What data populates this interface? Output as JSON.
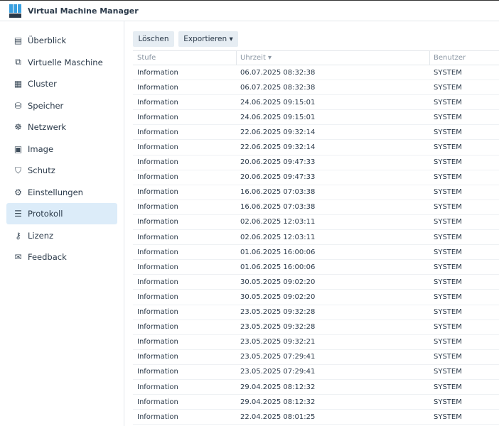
{
  "app": {
    "title": "Virtual Machine Manager"
  },
  "sidebar": {
    "items": [
      {
        "label": "Überblick",
        "icon": "overview-icon",
        "glyph": "▤"
      },
      {
        "label": "Virtuelle Maschine",
        "icon": "virtual-machine-icon",
        "glyph": "⧉"
      },
      {
        "label": "Cluster",
        "icon": "cluster-icon",
        "glyph": "▦"
      },
      {
        "label": "Speicher",
        "icon": "storage-icon",
        "glyph": "⛁"
      },
      {
        "label": "Netzwerk",
        "icon": "network-icon",
        "glyph": "☸"
      },
      {
        "label": "Image",
        "icon": "image-icon",
        "glyph": "▣"
      },
      {
        "label": "Schutz",
        "icon": "shield-icon",
        "glyph": "⛉"
      },
      {
        "label": "Einstellungen",
        "icon": "gear-icon",
        "glyph": "⚙"
      },
      {
        "label": "Protokoll",
        "icon": "list-icon",
        "glyph": "☰",
        "active": true
      },
      {
        "label": "Lizenz",
        "icon": "key-icon",
        "glyph": "⚷"
      },
      {
        "label": "Feedback",
        "icon": "mail-icon",
        "glyph": "✉"
      }
    ]
  },
  "toolbar": {
    "delete_label": "Löschen",
    "export_label": "Exportieren ▾"
  },
  "table": {
    "columns": [
      "Stufe",
      "Uhrzeit ▾",
      "Benutzer"
    ],
    "rows": [
      [
        "Information",
        "06.07.2025 08:32:38",
        "SYSTEM"
      ],
      [
        "Information",
        "06.07.2025 08:32:38",
        "SYSTEM"
      ],
      [
        "Information",
        "24.06.2025 09:15:01",
        "SYSTEM"
      ],
      [
        "Information",
        "24.06.2025 09:15:01",
        "SYSTEM"
      ],
      [
        "Information",
        "22.06.2025 09:32:14",
        "SYSTEM"
      ],
      [
        "Information",
        "22.06.2025 09:32:14",
        "SYSTEM"
      ],
      [
        "Information",
        "20.06.2025 09:47:33",
        "SYSTEM"
      ],
      [
        "Information",
        "20.06.2025 09:47:33",
        "SYSTEM"
      ],
      [
        "Information",
        "16.06.2025 07:03:38",
        "SYSTEM"
      ],
      [
        "Information",
        "16.06.2025 07:03:38",
        "SYSTEM"
      ],
      [
        "Information",
        "02.06.2025 12:03:11",
        "SYSTEM"
      ],
      [
        "Information",
        "02.06.2025 12:03:11",
        "SYSTEM"
      ],
      [
        "Information",
        "01.06.2025 16:00:06",
        "SYSTEM"
      ],
      [
        "Information",
        "01.06.2025 16:00:06",
        "SYSTEM"
      ],
      [
        "Information",
        "30.05.2025 09:02:20",
        "SYSTEM"
      ],
      [
        "Information",
        "30.05.2025 09:02:20",
        "SYSTEM"
      ],
      [
        "Information",
        "23.05.2025 09:32:28",
        "SYSTEM"
      ],
      [
        "Information",
        "23.05.2025 09:32:28",
        "SYSTEM"
      ],
      [
        "Information",
        "23.05.2025 09:32:21",
        "SYSTEM"
      ],
      [
        "Information",
        "23.05.2025 07:29:41",
        "SYSTEM"
      ],
      [
        "Information",
        "23.05.2025 07:29:41",
        "SYSTEM"
      ],
      [
        "Information",
        "29.04.2025 08:12:32",
        "SYSTEM"
      ],
      [
        "Information",
        "29.04.2025 08:12:32",
        "SYSTEM"
      ],
      [
        "Information",
        "22.04.2025 08:01:25",
        "SYSTEM"
      ]
    ]
  }
}
